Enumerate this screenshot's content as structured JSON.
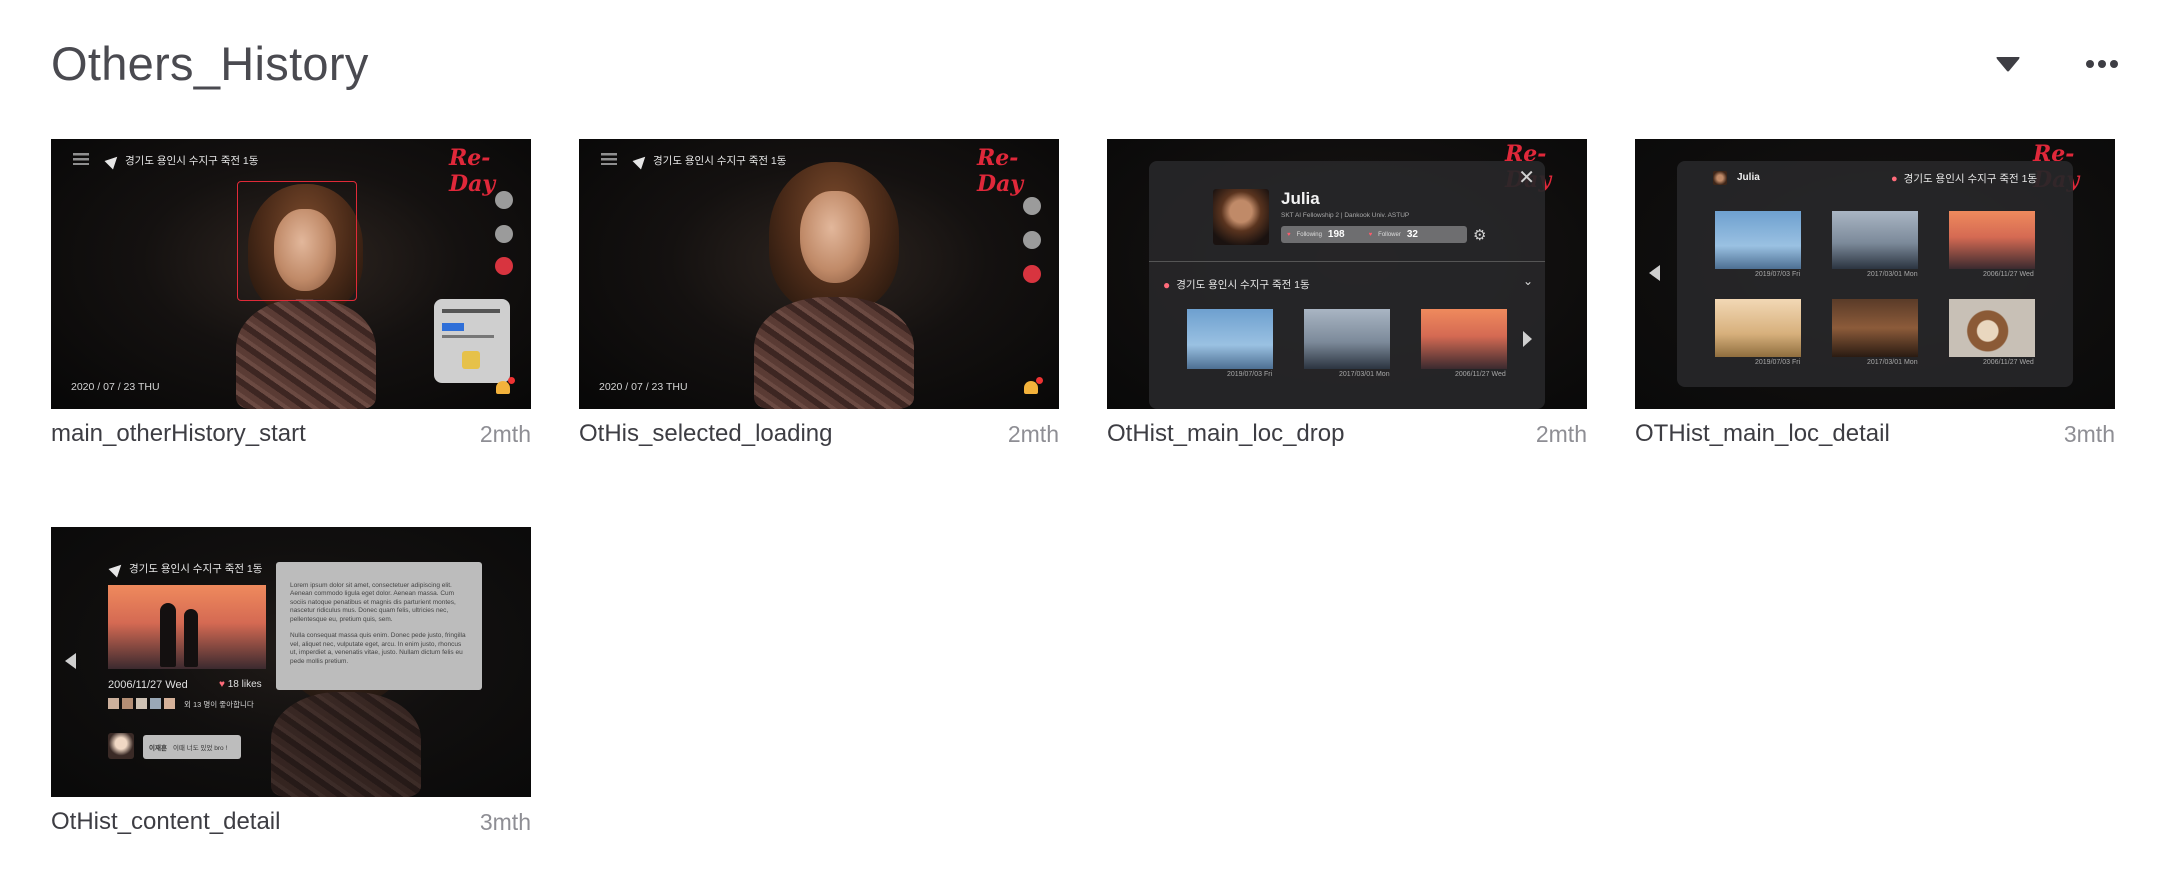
{
  "header": {
    "title": "Others_History",
    "caret_icon": "caret-down-icon",
    "more_icon": "more-horizontal-icon"
  },
  "cards": [
    {
      "name": "main_otherHistory_start",
      "age": "2mth",
      "screen": {
        "brand": "Re-Day",
        "location": "경기도 용인시 수지구 죽전 1동",
        "date": "2020 / 07 / 23    THU"
      }
    },
    {
      "name": "OtHis_selected_loading",
      "age": "2mth",
      "screen": {
        "brand": "Re-Day",
        "location": "경기도 용인시 수지구 죽전 1동",
        "date": "2020 / 07 / 23    THU"
      }
    },
    {
      "name": "OtHist_main_loc_drop",
      "age": "2mth",
      "screen": {
        "brand": "Re-Day",
        "profile_name": "Julia",
        "profile_sub": "SKT AI Fellowship 2 | Dankook Univ. ASTUP",
        "following_label": "Following",
        "following": "198",
        "follower_label": "Follower",
        "follower": "32",
        "location": "경기도 용인시 수지구 죽전 1동",
        "dates": [
          "2019/07/03 Fri",
          "2017/03/01 Mon",
          "2006/11/27 Wed"
        ]
      }
    },
    {
      "name": "OTHist_main_loc_detail",
      "age": "3mth",
      "screen": {
        "brand": "Re-Day",
        "user": "Julia",
        "location": "경기도 용인시 수지구 죽전 1동",
        "dates": [
          "2019/07/03 Fri",
          "2017/03/01 Mon",
          "2006/11/27 Wed",
          "2019/07/03 Fri",
          "2017/03/01 Mon",
          "2006/11/27 Wed"
        ]
      }
    },
    {
      "name": "OtHist_content_detail",
      "age": "3mth",
      "screen": {
        "location": "경기도 용인시 수지구 죽전 1동",
        "date": "2006/11/27   Wed",
        "likes": "18 likes",
        "liked_by": "외 13 명이 좋아합니다",
        "commenter": "이재훈",
        "comment": "이때 너도 있었 bro !",
        "text": "Lorem ipsum dolor sit amet, consectetuer adipiscing elit. Aenean commodo ligula eget dolor. Aenean massa. Cum sociis natoque penatibus et magnis dis parturient montes, nascetur ridiculus mus. Donec quam felis, ultricies nec, pellentesque eu, pretium quis, sem.\n\nNulla consequat massa quis enim. Donec pede justo, fringilla vel, aliquet nec, vulputate eget, arcu. In enim justo, rhoncus ut, imperdiet a, venenatis vitae, justo. Nullam dictum felis eu pede mollis pretium."
      }
    }
  ]
}
